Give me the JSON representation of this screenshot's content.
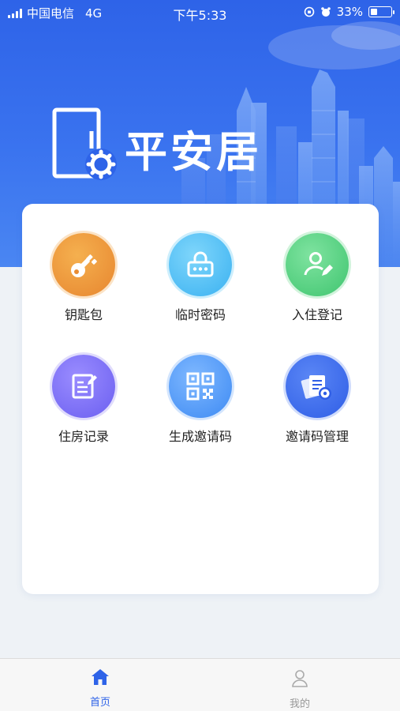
{
  "status_bar": {
    "carrier": "中国电信",
    "network": "4G",
    "time": "下午5:33",
    "battery": "33%",
    "battery_level": 0.33
  },
  "app": {
    "name": "平安居",
    "logo_icon": "door-gear-icon"
  },
  "menu": {
    "items": [
      {
        "label": "钥匙包",
        "icon": "key-icon",
        "color": "#e98c33"
      },
      {
        "label": "临时密码",
        "icon": "password-lock-icon",
        "color": "#3ab1f1"
      },
      {
        "label": "入住登记",
        "icon": "user-edit-icon",
        "color": "#3fc56f"
      },
      {
        "label": "住房记录",
        "icon": "note-edit-icon",
        "color": "#6b5ff0"
      },
      {
        "label": "生成邀请码",
        "icon": "qr-code-icon",
        "color": "#3d8af3"
      },
      {
        "label": "邀请码管理",
        "icon": "documents-gear-icon",
        "color": "#2f5ee6"
      }
    ]
  },
  "tabbar": {
    "tabs": [
      {
        "label": "首页",
        "icon": "home-icon",
        "active": true,
        "color": "#2e63e8"
      },
      {
        "label": "我的",
        "icon": "person-icon",
        "active": false,
        "color": "#999999"
      }
    ]
  }
}
